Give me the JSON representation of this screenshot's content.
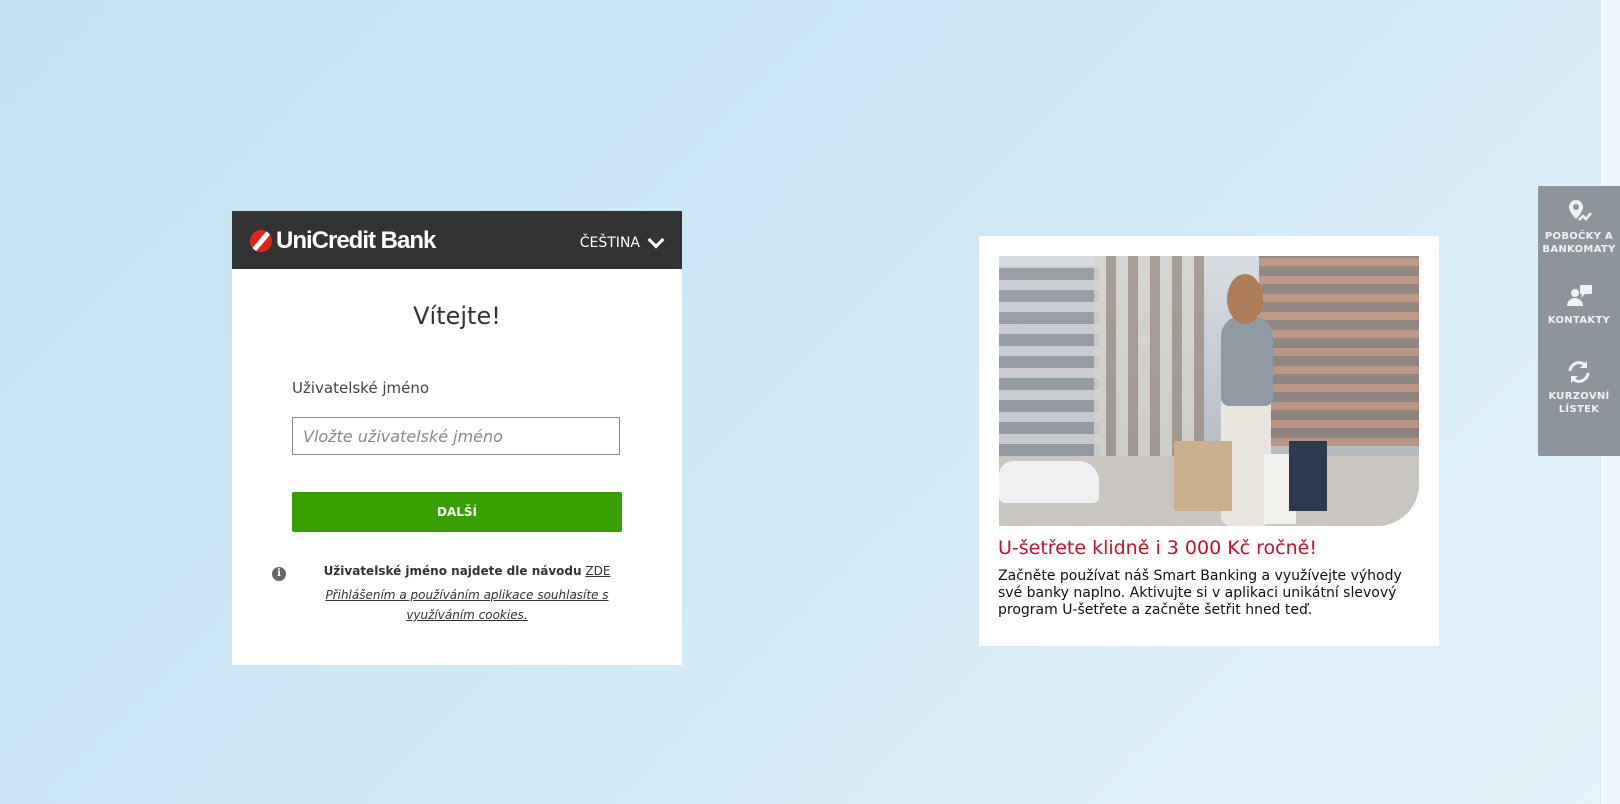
{
  "login": {
    "logo_text": "UniCredit Bank",
    "language": "ČEŠTINA",
    "welcome": "Vítejte!",
    "username_label": "Uživatelské jméno",
    "username_placeholder": "Vložte uživatelské jméno",
    "next_button": "DALŠÍ",
    "help_text": "Uživatelské jméno najdete dle návodu",
    "help_link": "ZDE",
    "cookie_note": "Přihlášením a používáním aplikace souhlasíte s využíváním cookies."
  },
  "promo": {
    "title": "U-šetřete klidně i 3 000 Kč ročně!",
    "text": "Začněte používat náš Smart Banking a využívejte výhody své banky naplno. Aktivujte si v aplikaci unikátní slevový program U-šetřete a začněte šetřit hned teď."
  },
  "side_tools": [
    {
      "label": "POBOČKY A BANKOMATY",
      "icon": "map-pin-icon"
    },
    {
      "label": "KONTAKTY",
      "icon": "contact-person-icon"
    },
    {
      "label": "KURZOVNÍ LÍSTEK",
      "icon": "refresh-icon"
    }
  ],
  "colors": {
    "header": "#333333",
    "primary_button": "#37a000",
    "promo_title": "#c8102e",
    "side_panel": "#8d949b"
  }
}
